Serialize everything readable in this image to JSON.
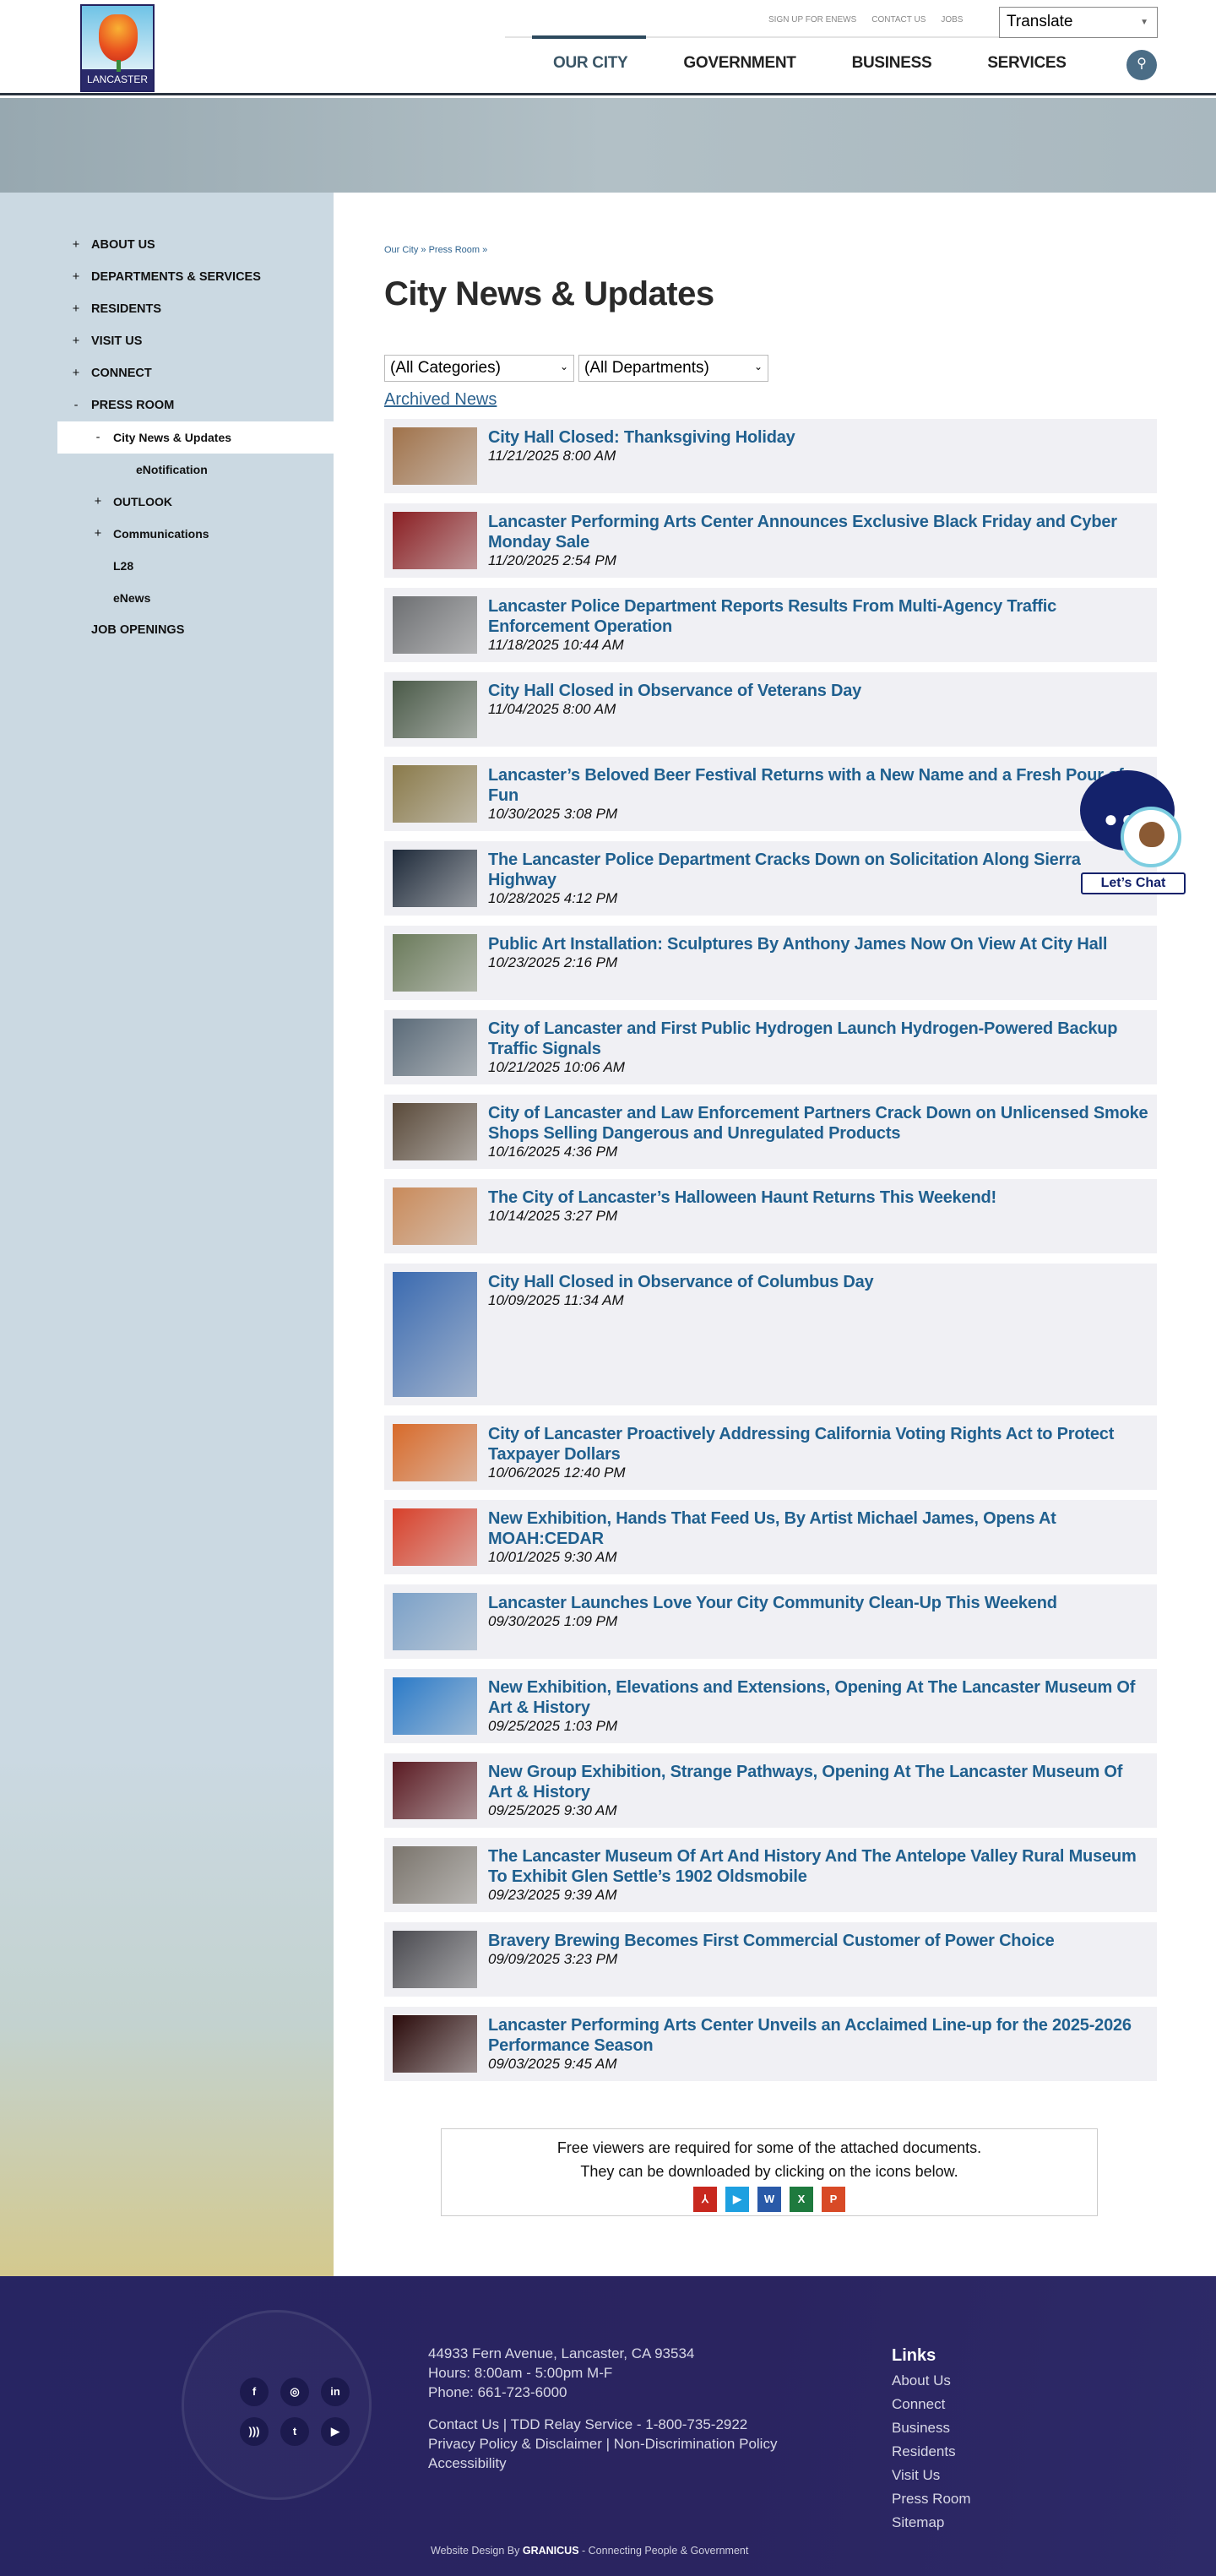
{
  "header": {
    "logo_text": "LANCASTER",
    "top_links": [
      "SIGN UP FOR ENEWS",
      "CONTACT US",
      "JOBS"
    ],
    "translate_label": "Translate",
    "nav": [
      "OUR CITY",
      "GOVERNMENT",
      "BUSINESS",
      "SERVICES"
    ],
    "active_nav": "OUR CITY"
  },
  "sidebar": {
    "items": [
      {
        "label": "ABOUT US",
        "symbol": "+"
      },
      {
        "label": "DEPARTMENTS & SERVICES",
        "symbol": "+"
      },
      {
        "label": "RESIDENTS",
        "symbol": "+"
      },
      {
        "label": "VISIT US",
        "symbol": "+"
      },
      {
        "label": "CONNECT",
        "symbol": "+"
      },
      {
        "label": "PRESS ROOM",
        "symbol": "-"
      },
      {
        "label": "City News & Updates",
        "symbol": "-"
      },
      {
        "label": "eNotification",
        "symbol": ""
      },
      {
        "label": "OUTLOOK",
        "symbol": "+"
      },
      {
        "label": "Communications",
        "symbol": "+"
      },
      {
        "label": "L28",
        "symbol": ""
      },
      {
        "label": "eNews",
        "symbol": ""
      },
      {
        "label": "JOB OPENINGS",
        "symbol": ""
      }
    ]
  },
  "main": {
    "breadcrumb": "Our City » Press Room »",
    "title": "City News & Updates",
    "category_filter": "(All Categories)",
    "department_filter": "(All Departments)",
    "archived_link": "Archived News",
    "news": [
      {
        "title": "City Hall Closed: Thanksgiving Holiday",
        "date": "11/21/2025 8:00 AM",
        "thumb": "#a0724a"
      },
      {
        "title": "Lancaster Performing Arts Center Announces Exclusive Black Friday and Cyber Monday Sale",
        "date": "11/20/2025 2:54 PM",
        "thumb": "#8a1e22"
      },
      {
        "title": "Lancaster Police Department Reports Results From Multi-Agency Traffic Enforcement Operation",
        "date": "11/18/2025 10:44 AM",
        "thumb": "#6d6f72"
      },
      {
        "title": "City Hall Closed in Observance of Veterans Day",
        "date": "11/04/2025 8:00 AM",
        "thumb": "#4a5a48"
      },
      {
        "title": "Lancaster’s Beloved Beer Festival Returns with a New Name and a Fresh Pour of Fun",
        "date": "10/30/2025 3:08 PM",
        "thumb": "#8a7a4a"
      },
      {
        "title": "The Lancaster Police Department Cracks Down on Solicitation Along Sierra Highway",
        "date": "10/28/2025 4:12 PM",
        "thumb": "#1e2a3a"
      },
      {
        "title": "Public Art Installation: Sculptures By Anthony James Now On View At City Hall",
        "date": "10/23/2025 2:16 PM",
        "thumb": "#6a7a5a"
      },
      {
        "title": "City of Lancaster and First Public Hydrogen Launch Hydrogen-Powered Backup Traffic Signals",
        "date": "10/21/2025 10:06 AM",
        "thumb": "#5a6a78"
      },
      {
        "title": "City of Lancaster and Law Enforcement Partners Crack Down on Unlicensed Smoke Shops Selling Dangerous and Unregulated Products",
        "date": "10/16/2025 4:36 PM",
        "thumb": "#5a4a3a"
      },
      {
        "title": "The City of Lancaster’s Halloween Haunt Returns This Weekend!",
        "date": "10/14/2025 3:27 PM",
        "thumb": "#c98a5a"
      },
      {
        "title": "City Hall Closed in Observance of Columbus Day",
        "date": "10/09/2025 11:34 AM",
        "thumb": "#3a6ab0",
        "tall": true
      },
      {
        "title": "City of Lancaster Proactively Addressing California Voting Rights Act to Protect Taxpayer Dollars",
        "date": "10/06/2025 12:40 PM",
        "thumb": "#d86a2a"
      },
      {
        "title": "New Exhibition, Hands That Feed Us, By Artist Michael James, Opens At MOAH:CEDAR",
        "date": "10/01/2025 9:30 AM",
        "thumb": "#d8402a"
      },
      {
        "title": "Lancaster Launches Love Your City Community Clean-Up This Weekend",
        "date": "09/30/2025 1:09 PM",
        "thumb": "#7aa0c8"
      },
      {
        "title": "New Exhibition, Elevations and Extensions, Opening At The Lancaster Museum Of Art & History",
        "date": "09/25/2025 1:03 PM",
        "thumb": "#2a7ac8"
      },
      {
        "title": "New Group Exhibition, Strange Pathways, Opening At The Lancaster Museum Of Art & History",
        "date": "09/25/2025 9:30 AM",
        "thumb": "#5a1a22"
      },
      {
        "title": "The Lancaster Museum Of Art And History And The Antelope Valley Rural Museum To Exhibit Glen Settle’s 1902 Oldsmobile",
        "date": "09/23/2025 9:39 AM",
        "thumb": "#7a746c"
      },
      {
        "title": "Bravery Brewing Becomes First Commercial Customer of Power Choice",
        "date": "09/09/2025 3:23 PM",
        "thumb": "#4a4a50"
      },
      {
        "title": "Lancaster Performing Arts Center Unveils an Acclaimed Line-up for the 2025-2026 Performance Season",
        "date": "09/03/2025 9:45 AM",
        "thumb": "#2a0a0a"
      }
    ]
  },
  "viewers": {
    "line1": "Free viewers are required for some of the attached documents.",
    "line2": "They can be downloaded by clicking on the icons below.",
    "icons": [
      {
        "name": "pdf-icon",
        "glyph": "⅄",
        "color": "#c8281e"
      },
      {
        "name": "media-player-icon",
        "glyph": "▶",
        "color": "#1ea0e0"
      },
      {
        "name": "word-icon",
        "glyph": "W",
        "color": "#2a5aa8"
      },
      {
        "name": "excel-icon",
        "glyph": "X",
        "color": "#1e7a3e"
      },
      {
        "name": "powerpoint-icon",
        "glyph": "P",
        "color": "#d84a26"
      }
    ]
  },
  "chat": {
    "label": "Let’s Chat"
  },
  "footer": {
    "address": "44933 Fern Avenue, Lancaster, CA 93534",
    "hours": "Hours: 8:00am - 5:00pm M-F",
    "phone": "Phone: 661-723-6000",
    "contact_line": "Contact Us | TDD Relay Service - 1-800-735-2922",
    "policy_line": "Privacy Policy & Disclaimer | Non-Discrimination Policy",
    "accessibility": "Accessibility",
    "links_heading": "Links",
    "links": [
      "About Us",
      "Connect",
      "Business",
      "Residents",
      "Visit Us",
      "Press Room",
      "Sitemap"
    ],
    "credit_prefix": "Website Design By",
    "credit_brand": "GRANICUS",
    "credit_suffix": "- Connecting People & Government"
  }
}
